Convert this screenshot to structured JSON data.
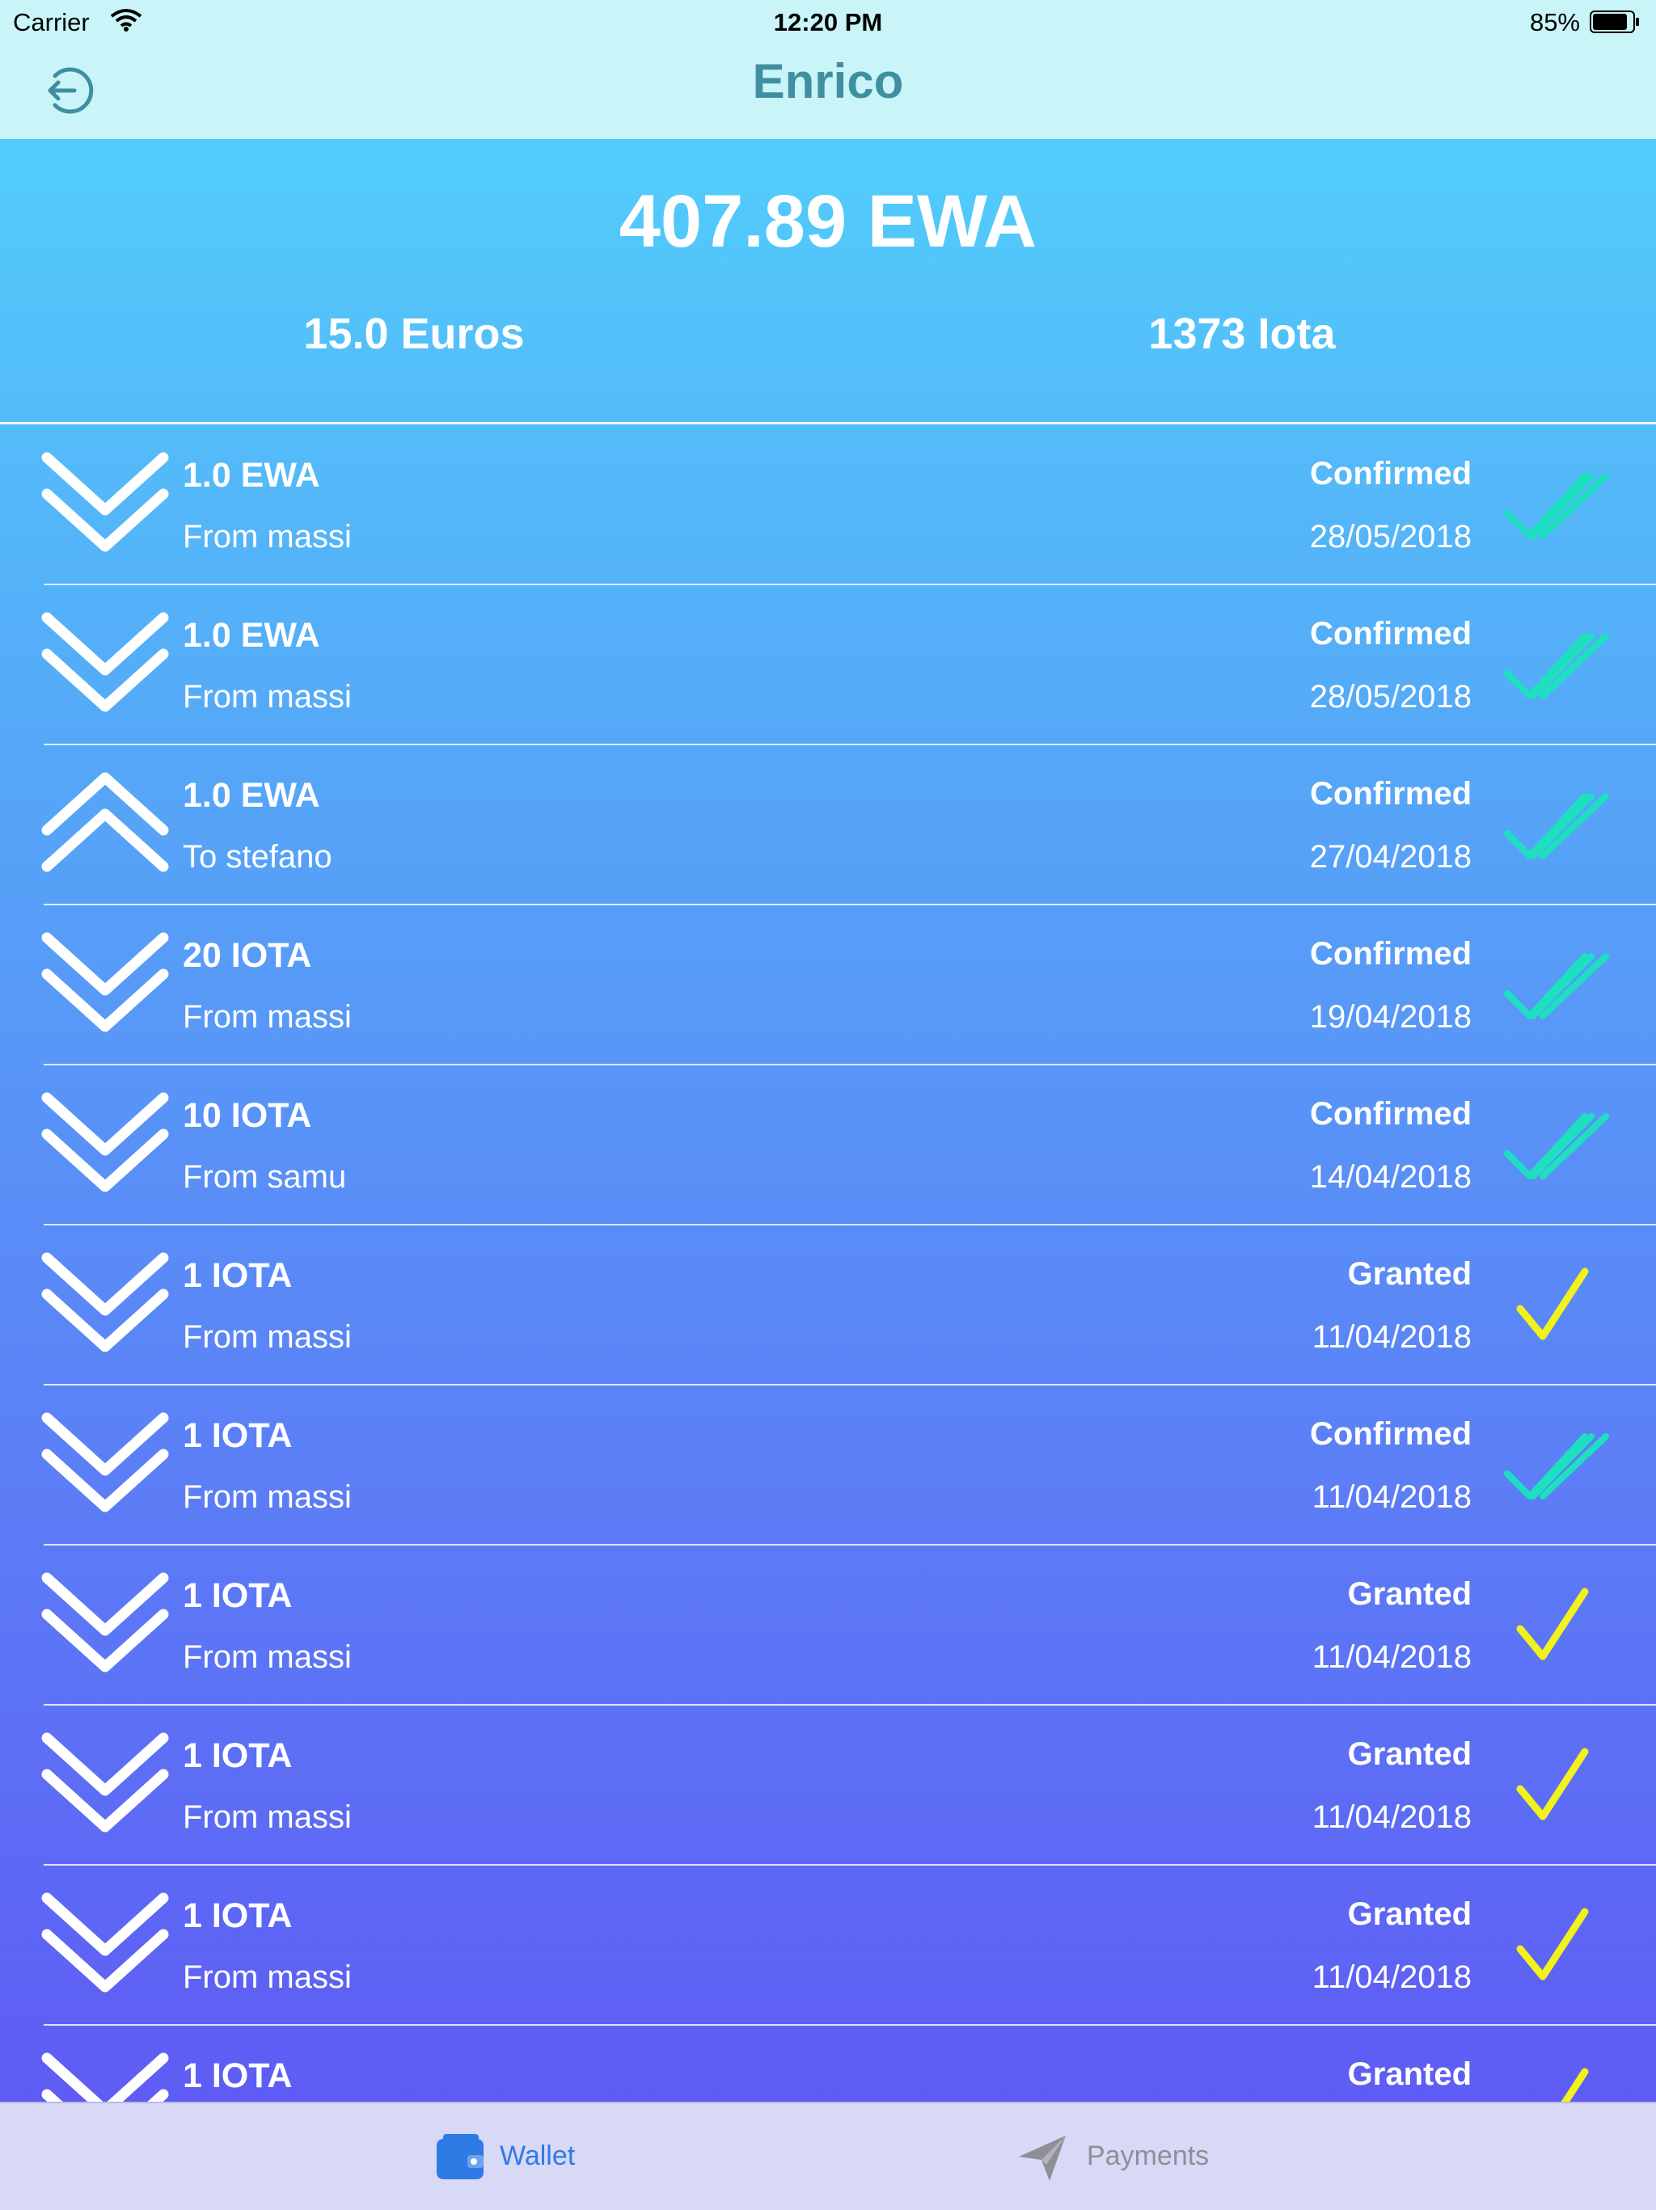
{
  "status_bar": {
    "carrier": "Carrier",
    "time": "12:20 PM",
    "battery": "85%"
  },
  "header": {
    "title": "Enrico"
  },
  "balance": {
    "main": "407.89 EWA",
    "euros": "15.0 Euros",
    "iota": "1373 Iota"
  },
  "transactions": [
    {
      "direction": "in",
      "amount": "1.0 EWA",
      "party": "From massi",
      "status": "Confirmed",
      "date": "28/05/2018"
    },
    {
      "direction": "in",
      "amount": "1.0 EWA",
      "party": "From massi",
      "status": "Confirmed",
      "date": "28/05/2018"
    },
    {
      "direction": "out",
      "amount": "1.0 EWA",
      "party": "To stefano",
      "status": "Confirmed",
      "date": "27/04/2018"
    },
    {
      "direction": "in",
      "amount": "20 IOTA",
      "party": "From massi",
      "status": "Confirmed",
      "date": "19/04/2018"
    },
    {
      "direction": "in",
      "amount": "10 IOTA",
      "party": "From samu",
      "status": "Confirmed",
      "date": "14/04/2018"
    },
    {
      "direction": "in",
      "amount": "1 IOTA",
      "party": "From massi",
      "status": "Granted",
      "date": "11/04/2018"
    },
    {
      "direction": "in",
      "amount": "1 IOTA",
      "party": "From massi",
      "status": "Confirmed",
      "date": "11/04/2018"
    },
    {
      "direction": "in",
      "amount": "1 IOTA",
      "party": "From massi",
      "status": "Granted",
      "date": "11/04/2018"
    },
    {
      "direction": "in",
      "amount": "1 IOTA",
      "party": "From massi",
      "status": "Granted",
      "date": "11/04/2018"
    },
    {
      "direction": "in",
      "amount": "1 IOTA",
      "party": "From massi",
      "status": "Granted",
      "date": "11/04/2018"
    },
    {
      "direction": "in",
      "amount": "1 IOTA",
      "party": "",
      "status": "Granted",
      "date": ""
    }
  ],
  "colors": {
    "confirmed_check": "#1de0c0",
    "granted_check": "#f2f21a",
    "title": "#3f8fa0",
    "tab_active": "#2f7be6",
    "tab_inactive": "#8f8f98"
  },
  "icons": {
    "back": "logout-arrow-icon",
    "incoming": "double-chevron-down-icon",
    "outgoing": "double-chevron-up-icon",
    "confirmed": "double-check-icon",
    "granted": "check-icon",
    "wallet": "wallet-icon",
    "payments": "paper-plane-icon"
  },
  "tabbar": {
    "wallet_label": "Wallet",
    "payments_label": "Payments"
  }
}
